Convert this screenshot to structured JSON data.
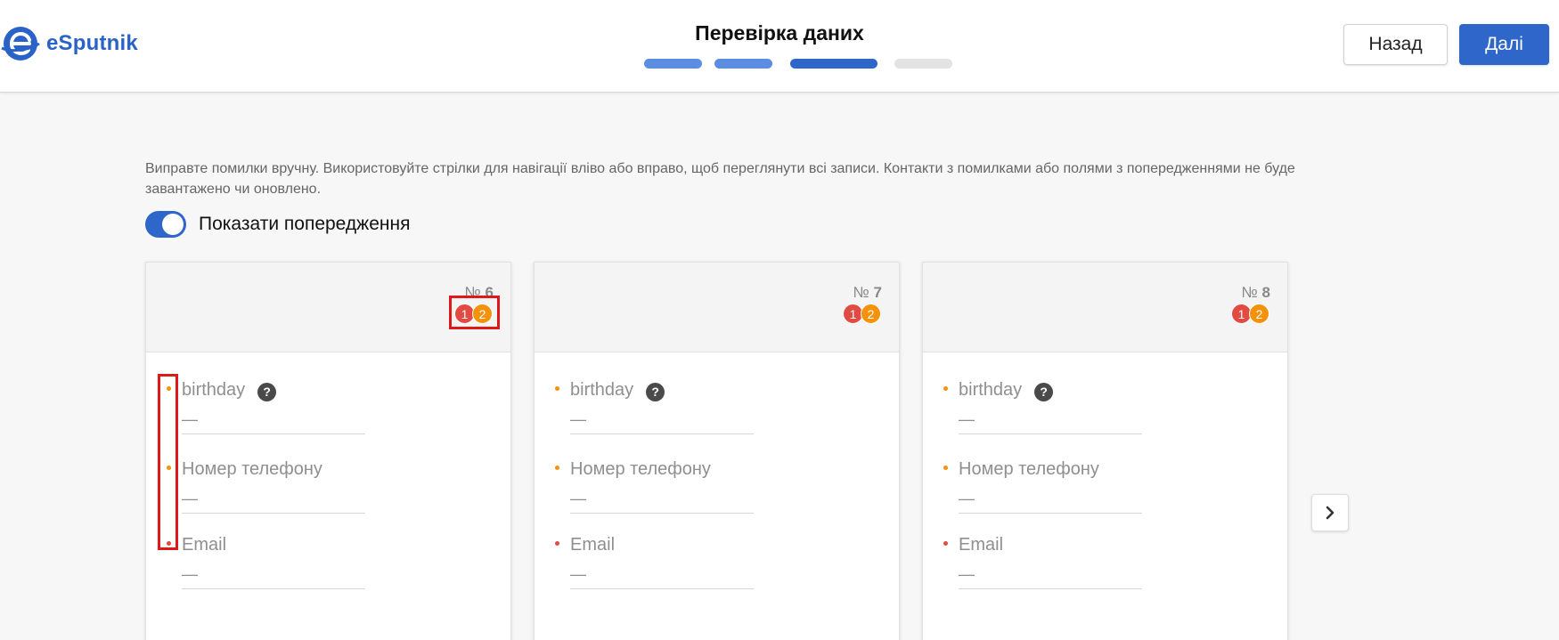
{
  "header": {
    "logo_text": "eSputnik",
    "title": "Перевірка даних",
    "back_label": "Назад",
    "next_label": "Далі",
    "steps": [
      {
        "state": "done",
        "color": "#5b8ee3"
      },
      {
        "state": "done",
        "color": "#5b8ee3"
      },
      {
        "state": "active",
        "color": "#2e66c9"
      },
      {
        "state": "todo",
        "color": "#e3e3e3"
      }
    ]
  },
  "content": {
    "heading": "",
    "instructions": "Виправте помилки вручну. Використовуйте стрілки для навігації вліво або вправо, щоб переглянути всі записи. Контакти з помилками або полями з попередженнями не буде завантажено чи оновлено.",
    "toggle_label": "Показати попередження",
    "toggle_on": true
  },
  "cards": [
    {
      "num_prefix": "№",
      "number": "6",
      "errors": "1",
      "warnings": "2",
      "fields": [
        {
          "label": "birthday",
          "value": "—",
          "status": "warning",
          "help": "?"
        },
        {
          "label": "Номер телефону",
          "value": "—",
          "status": "warning"
        },
        {
          "label": "Email",
          "value": "—",
          "status": "error"
        }
      ]
    },
    {
      "num_prefix": "№",
      "number": "7",
      "errors": "1",
      "warnings": "2",
      "fields": [
        {
          "label": "birthday",
          "value": "—",
          "status": "warning",
          "help": "?"
        },
        {
          "label": "Номер телефону",
          "value": "—",
          "status": "warning"
        },
        {
          "label": "Email",
          "value": "—",
          "status": "error"
        }
      ]
    },
    {
      "num_prefix": "№",
      "number": "8",
      "errors": "1",
      "warnings": "2",
      "fields": [
        {
          "label": "birthday",
          "value": "—",
          "status": "warning",
          "help": "?"
        },
        {
          "label": "Номер телефону",
          "value": "—",
          "status": "warning"
        },
        {
          "label": "Email",
          "value": "—",
          "status": "error"
        }
      ]
    }
  ],
  "colors": {
    "accent": "#2e66c9",
    "error": "#e34a42",
    "warning": "#f5920b",
    "annotation": "#e01818"
  },
  "icons": {
    "next": "chevron-right-icon",
    "help": "question-circle-icon"
  }
}
